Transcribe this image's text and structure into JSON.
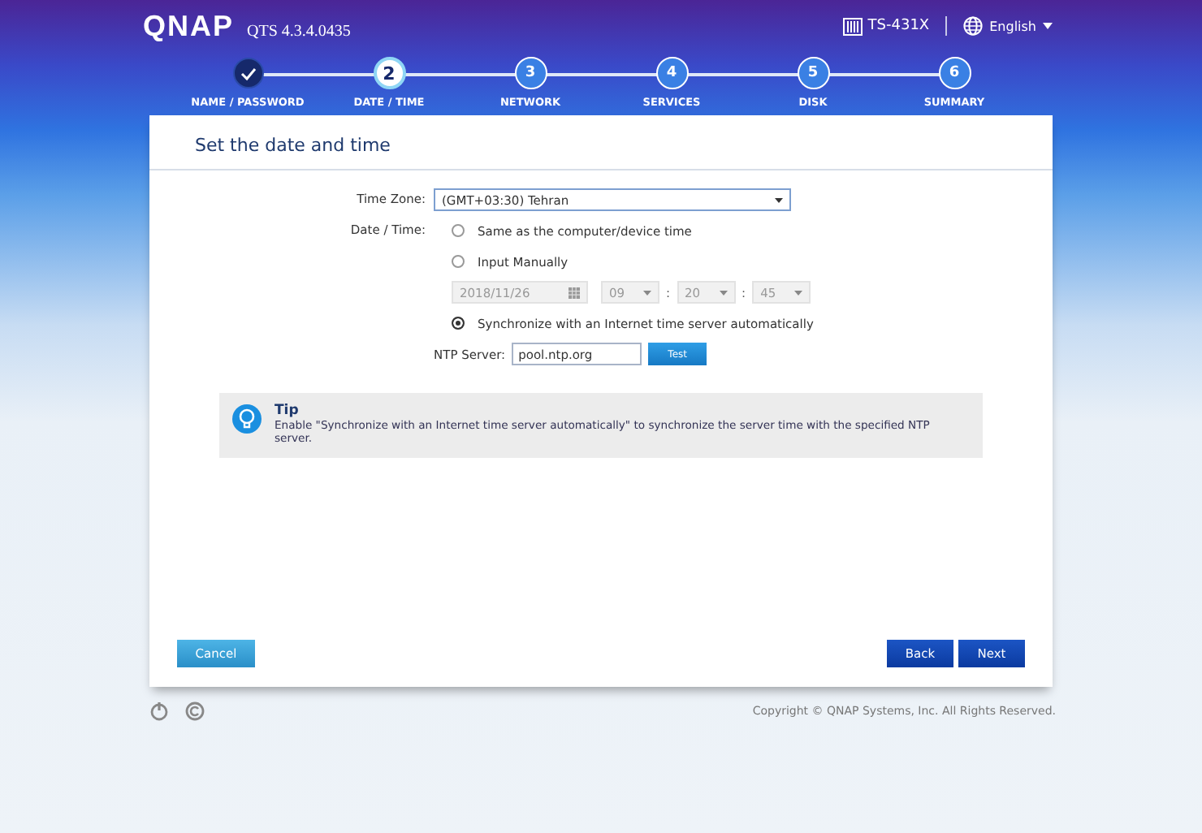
{
  "header": {
    "logo": "QNAP",
    "version": "QTS 4.3.4.0435",
    "device": "TS-431X",
    "language": "English"
  },
  "steps": [
    {
      "label": "NAME / PASSWORD",
      "completed": true,
      "selected": false
    },
    {
      "number": "2",
      "label": "DATE / TIME",
      "completed": false,
      "selected": true
    },
    {
      "number": "3",
      "label": "NETWORK",
      "completed": false,
      "selected": false
    },
    {
      "number": "4",
      "label": "SERVICES",
      "completed": false,
      "selected": false
    },
    {
      "number": "5",
      "label": "DISK",
      "completed": false,
      "selected": false
    },
    {
      "number": "6",
      "label": "SUMMARY",
      "completed": false,
      "selected": false
    }
  ],
  "panel": {
    "title": "Set the date and time",
    "time_zone": {
      "label": "Time Zone:",
      "value": "(GMT+03:30) Tehran"
    },
    "date_time": {
      "label": "Date / Time:",
      "options": [
        {
          "label": "Same as the computer/device time",
          "selected": false
        },
        {
          "label": "Input Manually",
          "selected": false
        },
        {
          "label": "Synchronize with an Internet time server automatically",
          "selected": true
        }
      ]
    },
    "manual": {
      "disabled": true,
      "date": "2018/11/26",
      "hour": "09",
      "minute": "20",
      "second": "45",
      "separator": ":"
    },
    "ntp": {
      "label": "NTP Server:",
      "value": "pool.ntp.org",
      "button": "Test"
    },
    "tip": {
      "title": "Tip",
      "text": "Enable \"Synchronize with an Internet time server automatically\" to synchronize the server time with the specified NTP server."
    },
    "buttons": {
      "cancel": "Cancel",
      "back": "Back",
      "next": "Next"
    }
  },
  "footer": {
    "copyright": "Copyright © QNAP Systems, Inc. All Rights Reserved."
  }
}
